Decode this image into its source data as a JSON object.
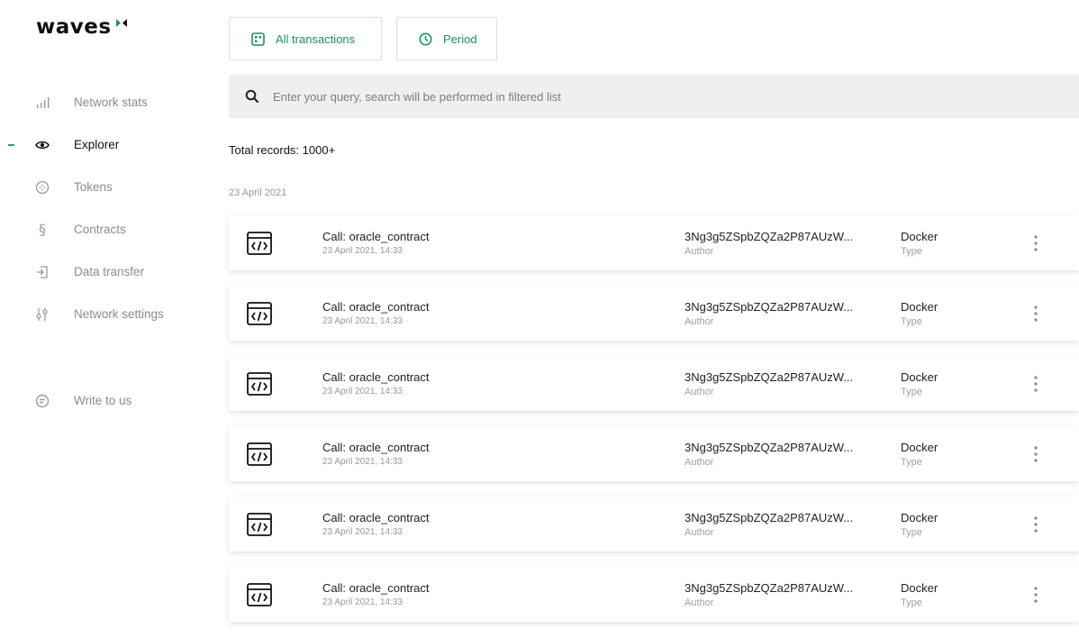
{
  "brand": {
    "name": "waves"
  },
  "sidebar": {
    "items": [
      {
        "label": "Network stats",
        "icon": "bar-chart-icon",
        "active": false
      },
      {
        "label": "Explorer",
        "icon": "eye-icon",
        "active": true
      },
      {
        "label": "Tokens",
        "icon": "token-icon",
        "active": false
      },
      {
        "label": "Contracts",
        "icon": "section-icon",
        "active": false
      },
      {
        "label": "Data transfer",
        "icon": "data-transfer-icon",
        "active": false
      },
      {
        "label": "Network settings",
        "icon": "sliders-icon",
        "active": false
      }
    ],
    "write_to_us": {
      "label": "Write to us",
      "icon": "chat-icon"
    }
  },
  "filters": {
    "all_transactions": "All transactions",
    "period": "Period"
  },
  "search": {
    "placeholder": "Enter your query, search will be performed in filtered list"
  },
  "total_records": "Total records: 1000+",
  "date_group": "23 April 2021",
  "transactions": [
    {
      "title": "Call: oracle_contract",
      "date": "23 April 2021, 14:33",
      "author": "3Ng3g5ZSpbZQZa2P87AUzW...",
      "author_label": "Author",
      "type": "Docker",
      "type_label": "Type"
    },
    {
      "title": "Call: oracle_contract",
      "date": "23 April 2021, 14:33",
      "author": "3Ng3g5ZSpbZQZa2P87AUzW...",
      "author_label": "Author",
      "type": "Docker",
      "type_label": "Type"
    },
    {
      "title": "Call: oracle_contract",
      "date": "23 April 2021, 14:33",
      "author": "3Ng3g5ZSpbZQZa2P87AUzW...",
      "author_label": "Author",
      "type": "Docker",
      "type_label": "Type"
    },
    {
      "title": "Call: oracle_contract",
      "date": "23 April 2021, 14:33",
      "author": "3Ng3g5ZSpbZQZa2P87AUzW...",
      "author_label": "Author",
      "type": "Docker",
      "type_label": "Type"
    },
    {
      "title": "Call: oracle_contract",
      "date": "23 April 2021, 14:33",
      "author": "3Ng3g5ZSpbZQZa2P87AUzW...",
      "author_label": "Author",
      "type": "Docker",
      "type_label": "Type"
    },
    {
      "title": "Call: oracle_contract",
      "date": "23 April 2021, 14:33",
      "author": "3Ng3g5ZSpbZQZa2P87AUzW...",
      "author_label": "Author",
      "type": "Docker",
      "type_label": "Type"
    }
  ],
  "colors": {
    "accent": "#1f8f5f",
    "active_marker": "#2e9e6b",
    "search_bg": "#eef0f0"
  }
}
